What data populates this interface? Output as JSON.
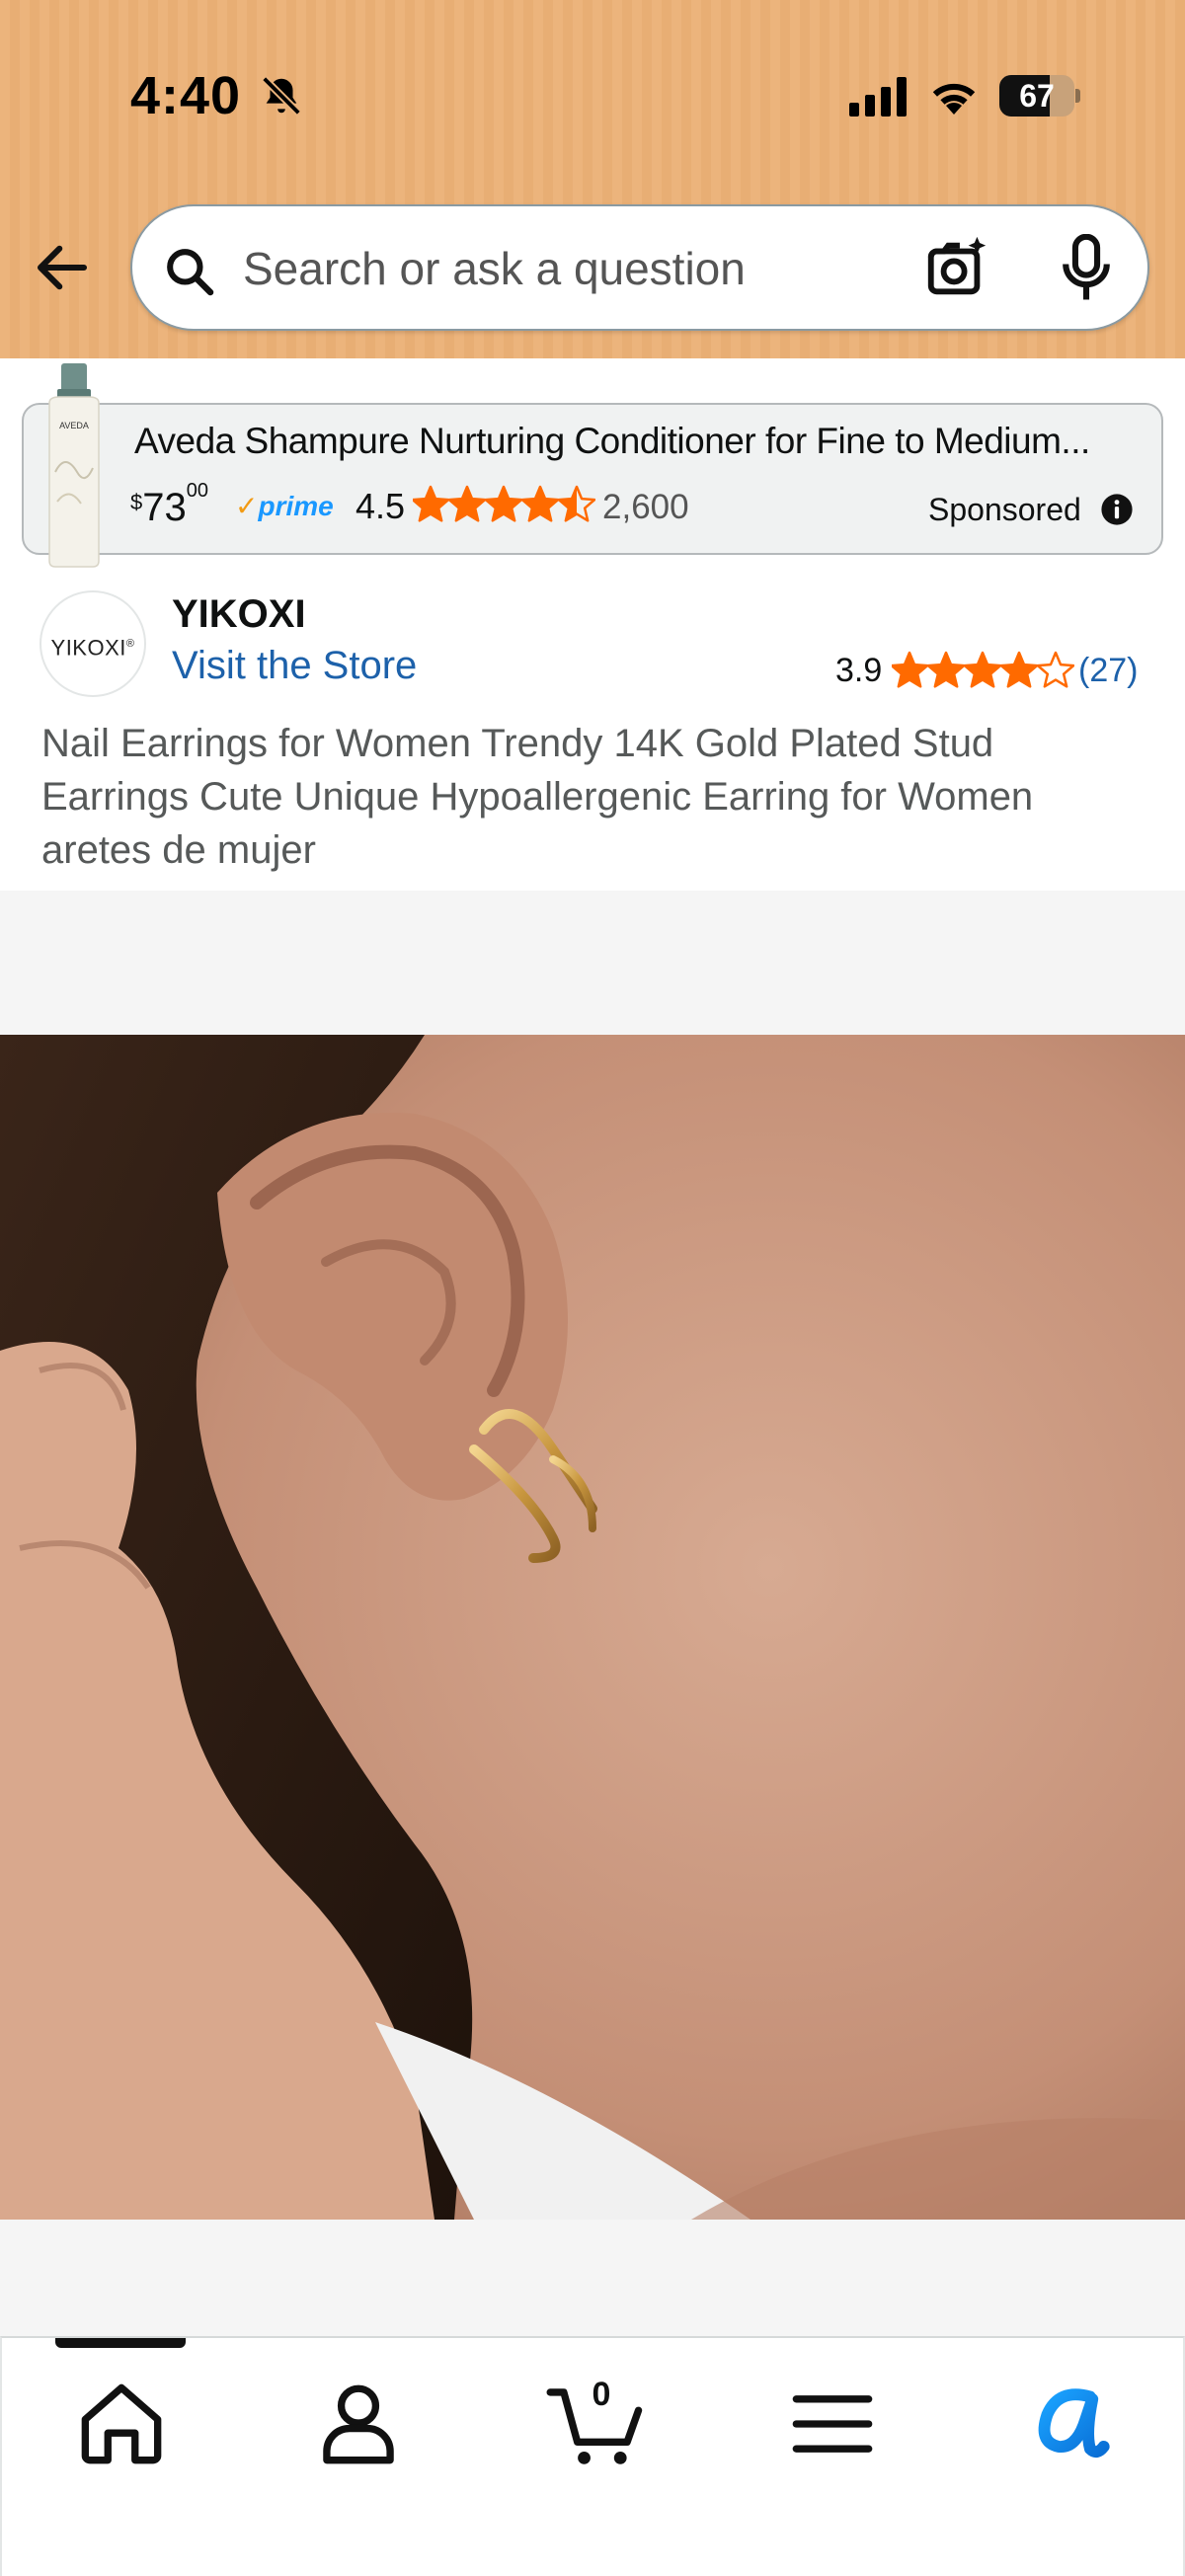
{
  "status_bar": {
    "time": "4:40",
    "battery": "67",
    "battery_level": 0.67
  },
  "search": {
    "placeholder": "Search or ask a question"
  },
  "sponsored": {
    "title": "Aveda Shampure Nurturing Conditioner for Fine to Medium...",
    "price_currency": "$",
    "price_whole": "73",
    "price_fraction": "00",
    "prime": "prime",
    "rating": "4.5",
    "rating_value": 4.5,
    "review_count": "2,600",
    "label": "Sponsored",
    "bottle_brand": "AVEDA"
  },
  "store": {
    "logo_text": "YIKOXI",
    "brand": "YIKOXI",
    "visit_label": "Visit the Store",
    "rating": "3.9",
    "rating_value": 3.9,
    "review_count": "(27)"
  },
  "product": {
    "title": "Nail Earrings for Women Trendy 14K Gold Plated Stud Earrings Cute Unique Hypoallergenic Earring for Women aretes de mujer"
  },
  "bottom_nav": {
    "items": [
      "home-icon",
      "account-icon",
      "cart-icon",
      "menu-icon",
      "rufus-icon"
    ],
    "cart_count": "0",
    "active": "home"
  },
  "colors": {
    "header_bg": "#ecb47c",
    "star": "#ff6a00",
    "link": "#1d61aa",
    "prime_blue": "#1a98ff",
    "rufus_blue": "#1aa3ff"
  }
}
